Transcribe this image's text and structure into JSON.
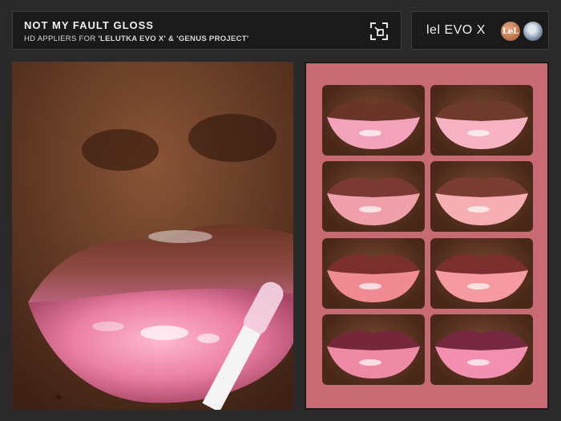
{
  "header": {
    "title": "NOT MY FAULT GLOSS",
    "subtitle_prefix": "HD APPLIERS FOR ",
    "subtitle_brand": "'LELUTKA EVO X' & 'GENUS PROJECT'"
  },
  "brand": {
    "text": "lel EVO X",
    "logo1_text": "LeL"
  },
  "colors": {
    "panel_bg": "#c76a73",
    "header_bg": "#1a1a1a",
    "accent_pink": "#f3a3bd"
  },
  "icons": {
    "expand": "expand-icon"
  },
  "swatches": {
    "count": 8,
    "columns": 2,
    "rows": 4
  }
}
